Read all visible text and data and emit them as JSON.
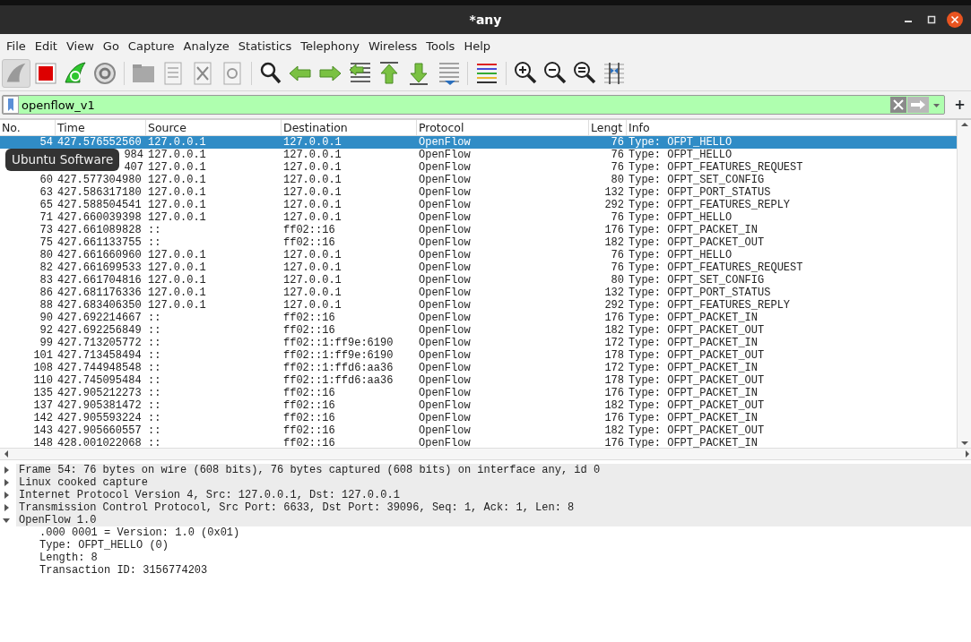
{
  "window": {
    "title": "*any"
  },
  "menu": [
    "File",
    "Edit",
    "View",
    "Go",
    "Capture",
    "Analyze",
    "Statistics",
    "Telephony",
    "Wireless",
    "Tools",
    "Help"
  ],
  "filter": {
    "value": "openflow_v1",
    "add_button": "+"
  },
  "tooltip": "Ubuntu Software",
  "packet_list": {
    "columns": [
      "No.",
      "Time",
      "Source",
      "Destination",
      "Protocol",
      "Lengt",
      "Info"
    ],
    "rows": [
      {
        "no": "54",
        "time": "427.576552560",
        "source": "127.0.0.1",
        "destination": "127.0.0.1",
        "protocol": "OpenFlow",
        "length": "76",
        "info": "Type: OFPT_HELLO",
        "selected": true
      },
      {
        "time": "984",
        "source": "127.0.0.1",
        "destination": "127.0.0.1",
        "protocol": "OpenFlow",
        "length": "76",
        "info": "Type: OFPT_HELLO",
        "selected": false
      },
      {
        "time": "407",
        "source": "127.0.0.1",
        "destination": "127.0.0.1",
        "protocol": "OpenFlow",
        "length": "76",
        "info": "Type: OFPT_FEATURES_REQUEST",
        "selected": false
      },
      {
        "no": "60",
        "time": "427.577304980",
        "source": "127.0.0.1",
        "destination": "127.0.0.1",
        "protocol": "OpenFlow",
        "length": "80",
        "info": "Type: OFPT_SET_CONFIG",
        "selected": false
      },
      {
        "no": "63",
        "time": "427.586317180",
        "source": "127.0.0.1",
        "destination": "127.0.0.1",
        "protocol": "OpenFlow",
        "length": "132",
        "info": "Type: OFPT_PORT_STATUS",
        "selected": false
      },
      {
        "no": "65",
        "time": "427.588504541",
        "source": "127.0.0.1",
        "destination": "127.0.0.1",
        "protocol": "OpenFlow",
        "length": "292",
        "info": "Type: OFPT_FEATURES_REPLY",
        "selected": false
      },
      {
        "no": "71",
        "time": "427.660039398",
        "source": "127.0.0.1",
        "destination": "127.0.0.1",
        "protocol": "OpenFlow",
        "length": "76",
        "info": "Type: OFPT_HELLO",
        "selected": false
      },
      {
        "no": "73",
        "time": "427.661089828",
        "source": "::",
        "destination": "ff02::16",
        "protocol": "OpenFlow",
        "length": "176",
        "info": "Type: OFPT_PACKET_IN",
        "selected": false
      },
      {
        "no": "75",
        "time": "427.661133755",
        "source": "::",
        "destination": "ff02::16",
        "protocol": "OpenFlow",
        "length": "182",
        "info": "Type: OFPT_PACKET_OUT",
        "selected": false
      },
      {
        "no": "80",
        "time": "427.661660960",
        "source": "127.0.0.1",
        "destination": "127.0.0.1",
        "protocol": "OpenFlow",
        "length": "76",
        "info": "Type: OFPT_HELLO",
        "selected": false
      },
      {
        "no": "82",
        "time": "427.661699533",
        "source": "127.0.0.1",
        "destination": "127.0.0.1",
        "protocol": "OpenFlow",
        "length": "76",
        "info": "Type: OFPT_FEATURES_REQUEST",
        "selected": false
      },
      {
        "no": "83",
        "time": "427.661704816",
        "source": "127.0.0.1",
        "destination": "127.0.0.1",
        "protocol": "OpenFlow",
        "length": "80",
        "info": "Type: OFPT_SET_CONFIG",
        "selected": false
      },
      {
        "no": "86",
        "time": "427.681176336",
        "source": "127.0.0.1",
        "destination": "127.0.0.1",
        "protocol": "OpenFlow",
        "length": "132",
        "info": "Type: OFPT_PORT_STATUS",
        "selected": false
      },
      {
        "no": "88",
        "time": "427.683406350",
        "source": "127.0.0.1",
        "destination": "127.0.0.1",
        "protocol": "OpenFlow",
        "length": "292",
        "info": "Type: OFPT_FEATURES_REPLY",
        "selected": false
      },
      {
        "no": "90",
        "time": "427.692214667",
        "source": "::",
        "destination": "ff02::16",
        "protocol": "OpenFlow",
        "length": "176",
        "info": "Type: OFPT_PACKET_IN",
        "selected": false
      },
      {
        "no": "92",
        "time": "427.692256849",
        "source": "::",
        "destination": "ff02::16",
        "protocol": "OpenFlow",
        "length": "182",
        "info": "Type: OFPT_PACKET_OUT",
        "selected": false
      },
      {
        "no": "99",
        "time": "427.713205772",
        "source": "::",
        "destination": "ff02::1:ff9e:6190",
        "protocol": "OpenFlow",
        "length": "172",
        "info": "Type: OFPT_PACKET_IN",
        "selected": false
      },
      {
        "no": "101",
        "time": "427.713458494",
        "source": "::",
        "destination": "ff02::1:ff9e:6190",
        "protocol": "OpenFlow",
        "length": "178",
        "info": "Type: OFPT_PACKET_OUT",
        "selected": false
      },
      {
        "no": "108",
        "time": "427.744948548",
        "source": "::",
        "destination": "ff02::1:ffd6:aa36",
        "protocol": "OpenFlow",
        "length": "172",
        "info": "Type: OFPT_PACKET_IN",
        "selected": false
      },
      {
        "no": "110",
        "time": "427.745095484",
        "source": "::",
        "destination": "ff02::1:ffd6:aa36",
        "protocol": "OpenFlow",
        "length": "178",
        "info": "Type: OFPT_PACKET_OUT",
        "selected": false
      },
      {
        "no": "135",
        "time": "427.905212273",
        "source": "::",
        "destination": "ff02::16",
        "protocol": "OpenFlow",
        "length": "176",
        "info": "Type: OFPT_PACKET_IN",
        "selected": false
      },
      {
        "no": "137",
        "time": "427.905381472",
        "source": "::",
        "destination": "ff02::16",
        "protocol": "OpenFlow",
        "length": "182",
        "info": "Type: OFPT_PACKET_OUT",
        "selected": false
      },
      {
        "no": "142",
        "time": "427.905593224",
        "source": "::",
        "destination": "ff02::16",
        "protocol": "OpenFlow",
        "length": "176",
        "info": "Type: OFPT_PACKET_IN",
        "selected": false
      },
      {
        "no": "143",
        "time": "427.905660557",
        "source": "::",
        "destination": "ff02::16",
        "protocol": "OpenFlow",
        "length": "182",
        "info": "Type: OFPT_PACKET_OUT",
        "selected": false
      },
      {
        "no": "148",
        "time": "428.001022068",
        "source": "::",
        "destination": "ff02::16",
        "protocol": "OpenFlow",
        "length": "176",
        "info": "Type: OFPT_PACKET_IN",
        "selected": false
      }
    ]
  },
  "details": [
    {
      "label": "Frame 54: 76 bytes on wire (608 bits), 76 bytes captured (608 bits) on interface any, id 0",
      "expanded": false
    },
    {
      "label": "Linux cooked capture",
      "expanded": false
    },
    {
      "label": "Internet Protocol Version 4, Src: 127.0.0.1, Dst: 127.0.0.1",
      "expanded": false
    },
    {
      "label": "Transmission Control Protocol, Src Port: 6633, Dst Port: 39096, Seq: 1, Ack: 1, Len: 8",
      "expanded": false
    },
    {
      "label": "OpenFlow 1.0",
      "expanded": true,
      "children": [
        {
          "label": ".000 0001 = Version: 1.0 (0x01)"
        },
        {
          "label": "Type: OFPT_HELLO (0)"
        },
        {
          "label": "Length: 8"
        },
        {
          "label": "Transaction ID: 3156774203"
        }
      ]
    }
  ]
}
